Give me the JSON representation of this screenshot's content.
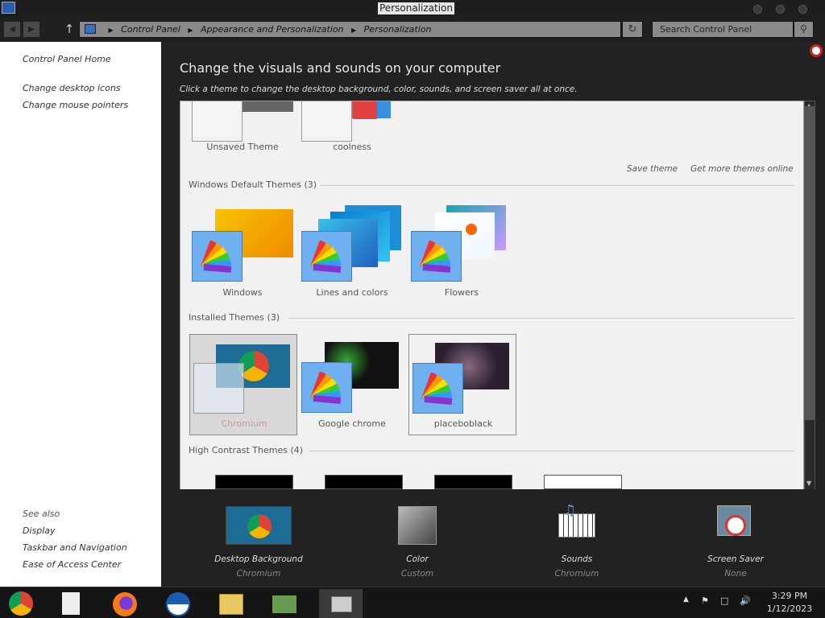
{
  "window": {
    "title": "Personalization"
  },
  "address": {
    "crumbs": [
      "Control Panel",
      "Appearance and Personalization",
      "Personalization"
    ]
  },
  "search": {
    "placeholder": "Search Control Panel"
  },
  "sidebar": {
    "home": "Control Panel Home",
    "links": [
      "Change desktop icons",
      "Change mouse pointers"
    ],
    "see_also_heading": "See also",
    "see_also": [
      "Display",
      "Taskbar and Navigation",
      "Ease of Access Center"
    ]
  },
  "main": {
    "heading": "Change the visuals and sounds on your computer",
    "subheading": "Click a theme to change the desktop background, color, sounds, and screen saver all at once."
  },
  "my_themes": {
    "items": [
      "Unsaved Theme",
      "coolness"
    ]
  },
  "actions": {
    "save_theme": "Save theme",
    "get_more": "Get more themes online"
  },
  "sections": {
    "windows_default": "Windows Default Themes (3)",
    "installed": "Installed Themes (3)",
    "high_contrast": "High Contrast Themes (4)"
  },
  "windows_default": {
    "items": [
      "Windows",
      "Lines and colors",
      "Flowers"
    ]
  },
  "installed": {
    "items": [
      "Chromium",
      "Google chrome",
      "placeboblack"
    ],
    "selected": "Chromium"
  },
  "bottom": {
    "items": [
      {
        "title": "Desktop Background",
        "value": "Chromium"
      },
      {
        "title": "Color",
        "value": "Custom"
      },
      {
        "title": "Sounds",
        "value": "Chromium"
      },
      {
        "title": "Screen Saver",
        "value": "None"
      }
    ]
  },
  "taskbar": {
    "time": "3:29 PM",
    "date": "1/12/2023"
  },
  "colors": {
    "window_bg": "#222222",
    "panel_bg": "#f1f1f1",
    "sidebar_bg": "#ffffff",
    "swatch": "#6fb0f0"
  }
}
